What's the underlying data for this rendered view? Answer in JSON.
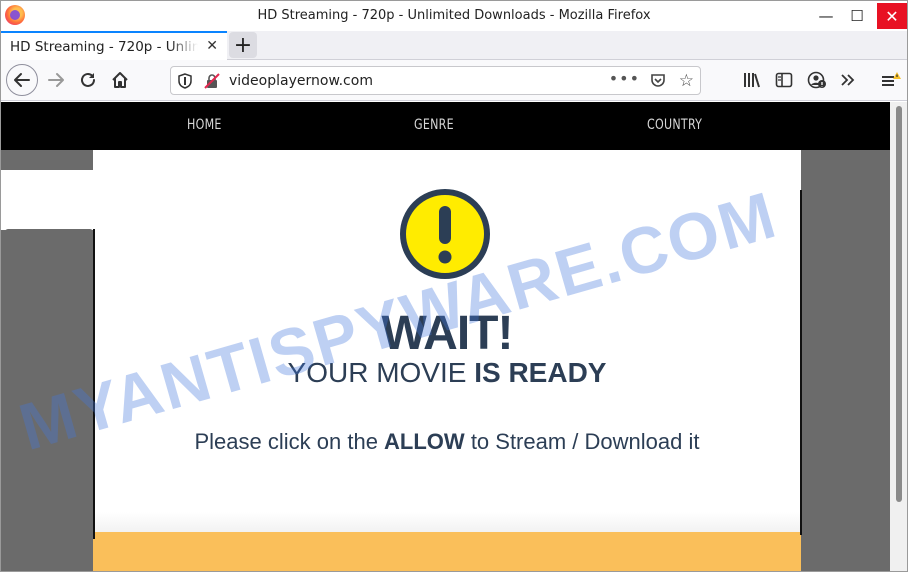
{
  "window": {
    "title": "HD Streaming - 720p - Unlimited Downloads - Mozilla Firefox",
    "min_glyph": "—",
    "max_glyph": "☐",
    "close_glyph": "✕"
  },
  "tabs": [
    {
      "title": "HD Streaming - 720p - Unlimited Downloads",
      "close_glyph": "✕",
      "active": true
    }
  ],
  "newtab_glyph": "+",
  "urlbar": {
    "url": "videoplayernow.com",
    "page_actions_glyph": "•••",
    "bookmark_glyph": "☆"
  },
  "site": {
    "nav": [
      "HOME",
      "GENRE",
      "COUNTRY"
    ],
    "headline": "WAIT!",
    "subline_normal": "YOUR MOVIE ",
    "subline_bold": "IS READY",
    "instruction_pre": "Please click on the ",
    "instruction_bold": "ALLOW",
    "instruction_post": " to Stream / Download it",
    "accent_color": "#fabf5a",
    "warning_color": "#ffec00",
    "text_color": "#2c3e55"
  },
  "watermark": "MYANTISPYWARE.COM",
  "icons": {
    "back": "back-arrow-icon",
    "forward": "forward-arrow-icon",
    "reload": "reload-icon",
    "home": "home-icon",
    "tracking": "shield-icon",
    "insecure": "insecure-lock-icon",
    "pocket": "pocket-icon",
    "library": "library-icon",
    "sidebar": "sidebar-icon",
    "account": "account-icon",
    "overflow": "overflow-chevron-icon",
    "menu": "hamburger-menu-icon",
    "warning": "exclamation-warning-icon"
  }
}
